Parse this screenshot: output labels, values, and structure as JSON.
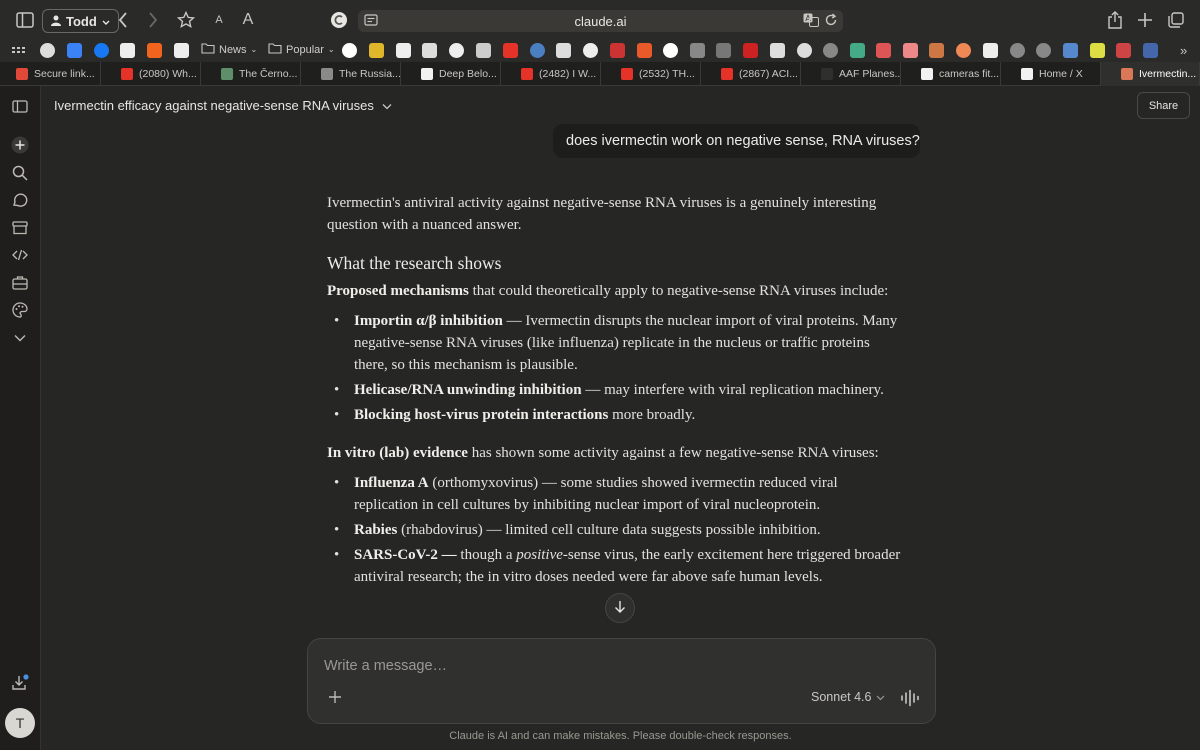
{
  "browser": {
    "profile_name": "Todd",
    "address": "claude.ai",
    "favorites_folders": [
      "News",
      "Popular"
    ],
    "tabs": [
      {
        "label": "Secure link...",
        "color": "#e0493a"
      },
      {
        "label": "(2080) Wh...",
        "color": "#e5332a"
      },
      {
        "label": "The Černo...",
        "color": "#5f8f6a"
      },
      {
        "label": "The Russia...",
        "color": "#8a8a8a"
      },
      {
        "label": "Deep Belo...",
        "color": "#f2f2f2"
      },
      {
        "label": "(2482) I W...",
        "color": "#e5332a"
      },
      {
        "label": "(2532) TH...",
        "color": "#e5332a"
      },
      {
        "label": "(2867) ACI...",
        "color": "#e5332a"
      },
      {
        "label": "AAF Planes...",
        "color": "#2f2f2d"
      },
      {
        "label": "cameras fit...",
        "color": "#f2f2f2"
      },
      {
        "label": "Home / X",
        "color": "#f2f2f2"
      },
      {
        "label": "Ivermectin...",
        "color": "#d97757"
      }
    ]
  },
  "chat": {
    "title": "Ivermectin efficacy against negative-sense RNA viruses",
    "share_label": "Share",
    "user_message": "does ivermectin work on negative sense, RNA viruses?",
    "response": {
      "intro": "Ivermectin's antiviral activity against negative-sense RNA viruses is a genuinely interesting question with a nuanced answer.",
      "heading": "What the research shows",
      "mech_lead_bold": "Proposed mechanisms",
      "mech_lead_rest": " that could theoretically apply to negative-sense RNA viruses include:",
      "mechanisms": [
        {
          "bold": "Importin α/β inhibition",
          "rest": " — Ivermectin disrupts the nuclear import of viral proteins. Many negative-sense RNA viruses (like influenza) replicate in the nucleus or traffic proteins there, so this mechanism is plausible."
        },
        {
          "bold": "Helicase/RNA unwinding inhibition",
          "rest": " — may interfere with viral replication machinery."
        },
        {
          "bold": "Blocking host-virus protein interactions",
          "rest": " more broadly."
        }
      ],
      "vitro_lead_bold": "In vitro (lab) evidence",
      "vitro_lead_rest": " has shown some activity against a few negative-sense RNA viruses:",
      "vitro": [
        {
          "bold": "Influenza A",
          "rest": " (orthomyxovirus) — some studies showed ivermectin reduced viral replication in cell cultures by inhibiting nuclear import of viral nucleoprotein."
        },
        {
          "bold": "Rabies",
          "rest": " (rhabdovirus) — limited cell culture data suggests possible inhibition."
        }
      ],
      "sars_bold": "SARS-CoV-2 —",
      "sars_pre": " though a ",
      "sars_italic": "positive",
      "sars_post": "-sense virus, the early excitement here triggered broader antiviral research; the in vitro doses needed were far above safe human levels."
    }
  },
  "composer": {
    "placeholder": "Write a message…",
    "model": "Sonnet 4.6"
  },
  "footer": "Claude is AI and can make mistakes. Please double-check responses.",
  "avatar_initial": "T",
  "icons": [
    "sidebar-toggle-icon",
    "back-icon",
    "forward-icon",
    "star-icon",
    "text-size-icon",
    "translate-icon",
    "reload-icon",
    "share-icon",
    "new-tab-icon",
    "tabs-overview-icon",
    "new-chat-icon",
    "search-icon",
    "chats-icon",
    "projects-icon",
    "code-icon",
    "artifacts-icon",
    "palette-icon",
    "expand-icon",
    "download-icon",
    "arrow-down-icon",
    "plus-icon",
    "chevron-down-icon",
    "voice-icon"
  ]
}
